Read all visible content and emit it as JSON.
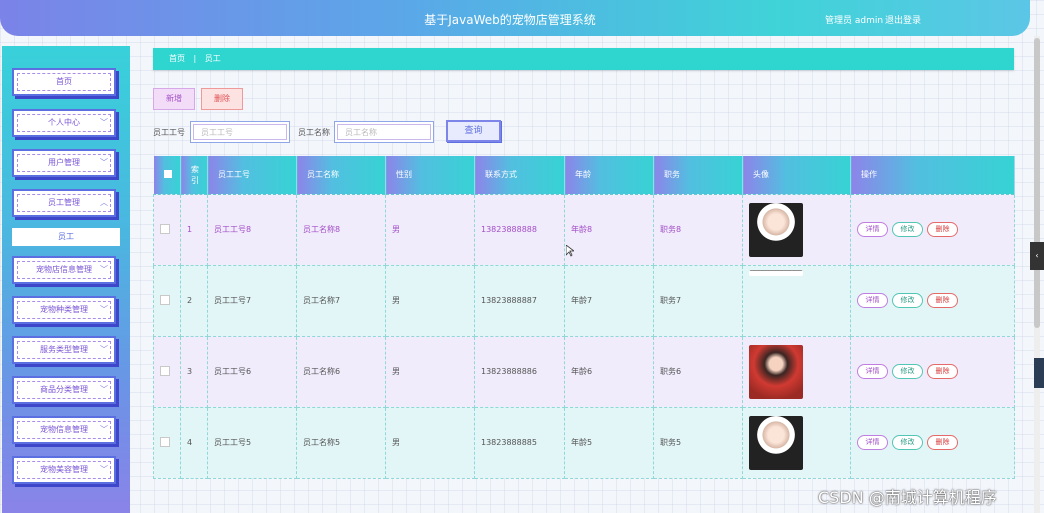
{
  "header": {
    "title": "基于JavaWeb的宠物店管理系统",
    "user": "管理员 admin",
    "logout": "退出登录"
  },
  "sidebar": {
    "items": [
      {
        "label": "首页",
        "chevron": false
      },
      {
        "label": "个人中心",
        "chevron": true
      },
      {
        "label": "用户管理",
        "chevron": true
      },
      {
        "label": "员工管理",
        "chevron": true,
        "expanded": true
      },
      {
        "label": "宠物店信息管理",
        "chevron": true
      },
      {
        "label": "宠物种类管理",
        "chevron": true
      },
      {
        "label": "服务类型管理",
        "chevron": true
      },
      {
        "label": "商品分类管理",
        "chevron": true
      },
      {
        "label": "宠物信息管理",
        "chevron": true
      },
      {
        "label": "宠物美容管理",
        "chevron": true
      }
    ],
    "submenu": "员工"
  },
  "breadcrumb": {
    "home": "首页",
    "sep": "|",
    "current": "员工"
  },
  "toolbar": {
    "add": "新增",
    "delete": "删除"
  },
  "search": {
    "field1_label": "员工工号",
    "field1_placeholder": "员工工号",
    "field2_label": "员工名称",
    "field2_placeholder": "员工名称",
    "button": "查询"
  },
  "table": {
    "headers": [
      "",
      "索引",
      "员工工号",
      "员工名称",
      "性别",
      "联系方式",
      "年龄",
      "职务",
      "头像",
      "操作"
    ],
    "rows": [
      {
        "index": "1",
        "job_no": "员工工号8",
        "name": "员工名称8",
        "gender": "男",
        "phone": "13823888888",
        "age": "年龄8",
        "position": "职务8",
        "avatar": "photo-girl-white-cap"
      },
      {
        "index": "2",
        "job_no": "员工工号7",
        "name": "员工名称7",
        "gender": "男",
        "phone": "13823888887",
        "age": "年龄7",
        "position": "职务7",
        "avatar": "photo-partial"
      },
      {
        "index": "3",
        "job_no": "员工工号6",
        "name": "员工名称6",
        "gender": "男",
        "phone": "13823888886",
        "age": "年龄6",
        "position": "职务6",
        "avatar": "photo-girl-red"
      },
      {
        "index": "4",
        "job_no": "员工工号5",
        "name": "员工名称5",
        "gender": "男",
        "phone": "13823888885",
        "age": "年龄5",
        "position": "职务5",
        "avatar": "photo-girl-white-cap"
      }
    ],
    "ops": {
      "detail": "详情",
      "edit": "修改",
      "delete": "删除"
    }
  },
  "watermark": "CSDN @南城计算机程序",
  "colors": {
    "header": "#5aa8e8",
    "accent": "#2ed6cf",
    "menu_border": "#5b6fe0"
  }
}
